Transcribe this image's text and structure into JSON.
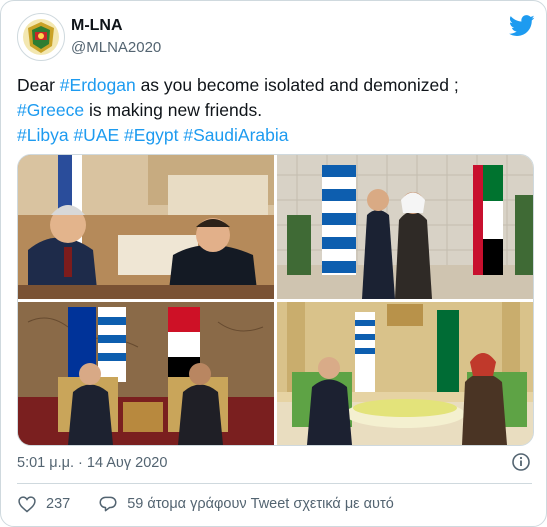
{
  "account": {
    "name": "M-LNA",
    "handle": "@MLNA2020"
  },
  "tweet": {
    "line1": [
      {
        "t": "Dear ",
        "tag": false
      },
      {
        "t": "#Erdogan",
        "tag": true
      },
      {
        "t": " as you become isolated and demonized ;",
        "tag": false
      }
    ],
    "line2": [
      {
        "t": "#Greece",
        "tag": true
      },
      {
        "t": " is making new friends.",
        "tag": false
      }
    ],
    "line3": [
      {
        "t": "#Libya",
        "tag": true
      },
      {
        "t": " ",
        "tag": false
      },
      {
        "t": "#UAE",
        "tag": true
      },
      {
        "t": " ",
        "tag": false
      },
      {
        "t": "#Egypt",
        "tag": true
      },
      {
        "t": " ",
        "tag": false
      },
      {
        "t": "#SaudiArabia",
        "tag": true
      }
    ]
  },
  "timestamp": "5:01 μ.μ. · 14 Αυγ 2020",
  "likes": {
    "count": "237"
  },
  "talking": {
    "text": "59 άτομα γράφουν Tweet σχετικά με αυτό"
  },
  "icons": {
    "brand": "twitter-bird-icon",
    "info": "info-icon",
    "like": "heart-icon",
    "reply": "speech-bubble-icon"
  },
  "colors": {
    "accent": "#1d9bf0",
    "secondary_text": "#536471",
    "border": "#cfd9de"
  }
}
